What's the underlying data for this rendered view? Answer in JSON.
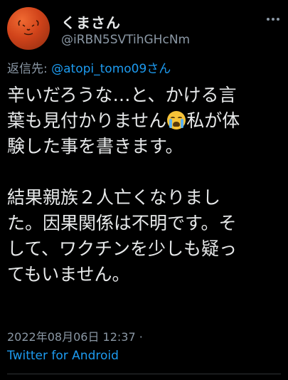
{
  "author": {
    "display_name": "くまさん",
    "handle": "@iRBN5SVTihGHcNm",
    "avatar_color": "#d0431a"
  },
  "more_icon": "more-dots-icon",
  "reply_to": {
    "prefix": "返信先: ",
    "username": "@atopi_tomo09さん"
  },
  "tweet": {
    "lines": [
      "辛いだろうな…と、かける言",
      "葉も見付かりません",
      "私が体",
      "験した事を書きます。",
      "結果親族２人亡くなりまし",
      "た。因果関係は不明です。そ",
      "して、ワクチンを少しも疑っ",
      "てもいません。"
    ],
    "emoji": "loudly-crying-face-icon"
  },
  "timestamp": "2022年08月06日 12:37 ·",
  "source": "Twitter for Android",
  "colors": {
    "background": "#000000",
    "text": "#e7e9ea",
    "secondary": "#8b98a5",
    "link": "#1d9bf0"
  }
}
